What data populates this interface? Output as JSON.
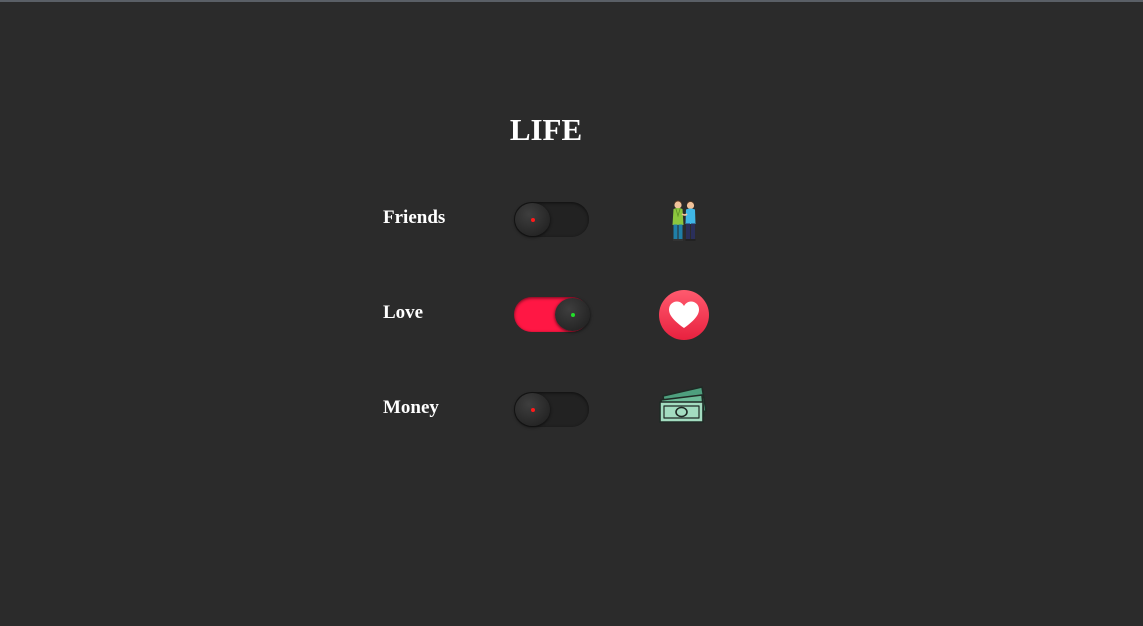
{
  "page": {
    "title": "LIFE"
  },
  "toggles": [
    {
      "label": "Friends",
      "checked": false,
      "indicator_color": "#ff1a1a",
      "icon": "friends-icon"
    },
    {
      "label": "Love",
      "checked": true,
      "indicator_color": "#22e02a",
      "track_color": "#ff1744",
      "icon": "heart-icon"
    },
    {
      "label": "Money",
      "checked": false,
      "indicator_color": "#ff1a1a",
      "icon": "money-icon"
    }
  ]
}
